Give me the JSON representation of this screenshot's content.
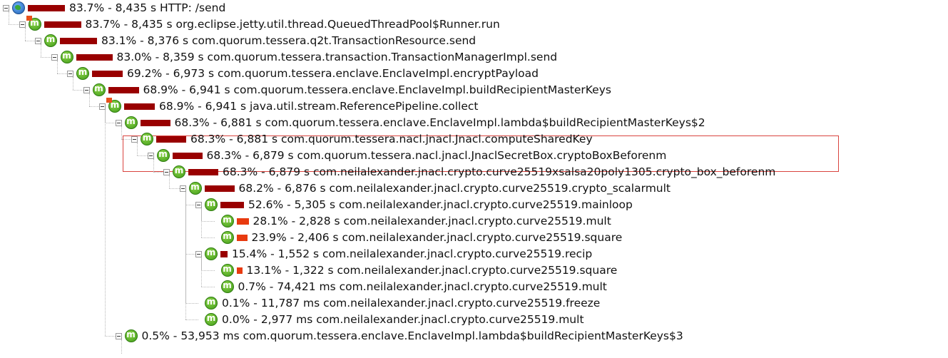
{
  "tree": {
    "rows": [
      {
        "text": "83.7% - 8,435 s HTTP: /send",
        "icon": "globe-icon",
        "depth": 0,
        "ratio": 0.837,
        "color": "dark",
        "flag": false
      },
      {
        "text": "83.7% - 8,435 s org.eclipse.jetty.util.thread.QueuedThreadPool$Runner.run",
        "icon": "method-icon",
        "depth": 1,
        "ratio": 0.837,
        "color": "dark",
        "flag": true
      },
      {
        "text": "83.1% - 8,376 s com.quorum.tessera.q2t.TransactionResource.send",
        "icon": "method-icon",
        "depth": 2,
        "ratio": 0.831,
        "color": "dark",
        "flag": false
      },
      {
        "text": "83.0% - 8,359 s com.quorum.tessera.transaction.TransactionManagerImpl.send",
        "icon": "method-icon",
        "depth": 3,
        "ratio": 0.83,
        "color": "dark",
        "flag": false
      },
      {
        "text": "69.2% - 6,973 s com.quorum.tessera.enclave.EnclaveImpl.encryptPayload",
        "icon": "method-icon",
        "depth": 4,
        "ratio": 0.692,
        "color": "dark",
        "flag": false
      },
      {
        "text": "68.9% - 6,941 s com.quorum.tessera.enclave.EnclaveImpl.buildRecipientMasterKeys",
        "icon": "method-icon",
        "depth": 5,
        "ratio": 0.689,
        "color": "dark",
        "flag": false
      },
      {
        "text": "68.9% - 6,941 s java.util.stream.ReferencePipeline.collect",
        "icon": "method-icon",
        "depth": 6,
        "ratio": 0.689,
        "color": "dark",
        "flag": true
      },
      {
        "text": "68.3% - 6,881 s com.quorum.tessera.enclave.EnclaveImpl.lambda$buildRecipientMasterKeys$2",
        "icon": "method-icon",
        "depth": 7,
        "ratio": 0.683,
        "color": "dark",
        "flag": false
      },
      {
        "text": "68.3% - 6,881 s com.quorum.tessera.nacl.jnacl.Jnacl.computeSharedKey",
        "icon": "method-icon",
        "depth": 8,
        "ratio": 0.683,
        "color": "dark",
        "flag": false
      },
      {
        "text": "68.3% - 6,879 s com.quorum.tessera.nacl.jnacl.JnaclSecretBox.cryptoBoxBeforenm",
        "icon": "method-icon",
        "depth": 9,
        "ratio": 0.683,
        "color": "dark",
        "flag": false
      },
      {
        "text": "68.3% - 6,879 s com.neilalexander.jnacl.crypto.curve25519xsalsa20poly1305.crypto_box_beforenm",
        "icon": "method-icon",
        "depth": 10,
        "ratio": 0.683,
        "color": "dark",
        "flag": false
      },
      {
        "text": "68.2% - 6,876 s com.neilalexander.jnacl.crypto.curve25519.crypto_scalarmult",
        "icon": "method-icon",
        "depth": 11,
        "ratio": 0.682,
        "color": "dark",
        "flag": false
      },
      {
        "text": "52.6% - 5,305 s com.neilalexander.jnacl.crypto.curve25519.mainloop",
        "icon": "method-icon",
        "depth": 12,
        "ratio": 0.526,
        "color": "dark",
        "flag": false
      },
      {
        "text": "28.1% - 2,828 s com.neilalexander.jnacl.crypto.curve25519.mult",
        "icon": "method-icon",
        "depth": 13,
        "ratio": 0.281,
        "color": "red",
        "flag": false
      },
      {
        "text": "23.9% - 2,406 s com.neilalexander.jnacl.crypto.curve25519.square",
        "icon": "method-icon",
        "depth": 13,
        "ratio": 0.239,
        "color": "red",
        "flag": false
      },
      {
        "text": "15.4% - 1,552 s com.neilalexander.jnacl.crypto.curve25519.recip",
        "icon": "method-icon",
        "depth": 12,
        "ratio": 0.154,
        "color": "dark",
        "flag": false
      },
      {
        "text": "13.1% - 1,322 s com.neilalexander.jnacl.crypto.curve25519.square",
        "icon": "method-icon",
        "depth": 13,
        "ratio": 0.131,
        "color": "red",
        "flag": false
      },
      {
        "text": "0.7% - 74,421 ms com.neilalexander.jnacl.crypto.curve25519.mult",
        "icon": "method-icon",
        "depth": 13,
        "ratio": 0.007,
        "color": "red",
        "flag": false
      },
      {
        "text": "0.1% - 11,787 ms com.neilalexander.jnacl.crypto.curve25519.freeze",
        "icon": "method-icon",
        "depth": 12,
        "ratio": 0.001,
        "color": "dark",
        "flag": false
      },
      {
        "text": "0.0% - 2,977 ms com.neilalexander.jnacl.crypto.curve25519.mult",
        "icon": "method-icon",
        "depth": 12,
        "ratio": 0.0,
        "color": "dark",
        "flag": false
      },
      {
        "text": "0.5% - 53,953 ms com.quorum.tessera.enclave.EnclaveImpl.lambda$buildRecipientMasterKeys$3",
        "icon": "method-icon",
        "depth": 7,
        "ratio": 0.005,
        "color": "dark",
        "flag": false
      }
    ],
    "highlighted_rows": [
      8,
      9
    ],
    "colors": {
      "bar_dark": "#990000",
      "bar_red": "#e83a0f",
      "highlight_border": "#d9443f"
    }
  }
}
